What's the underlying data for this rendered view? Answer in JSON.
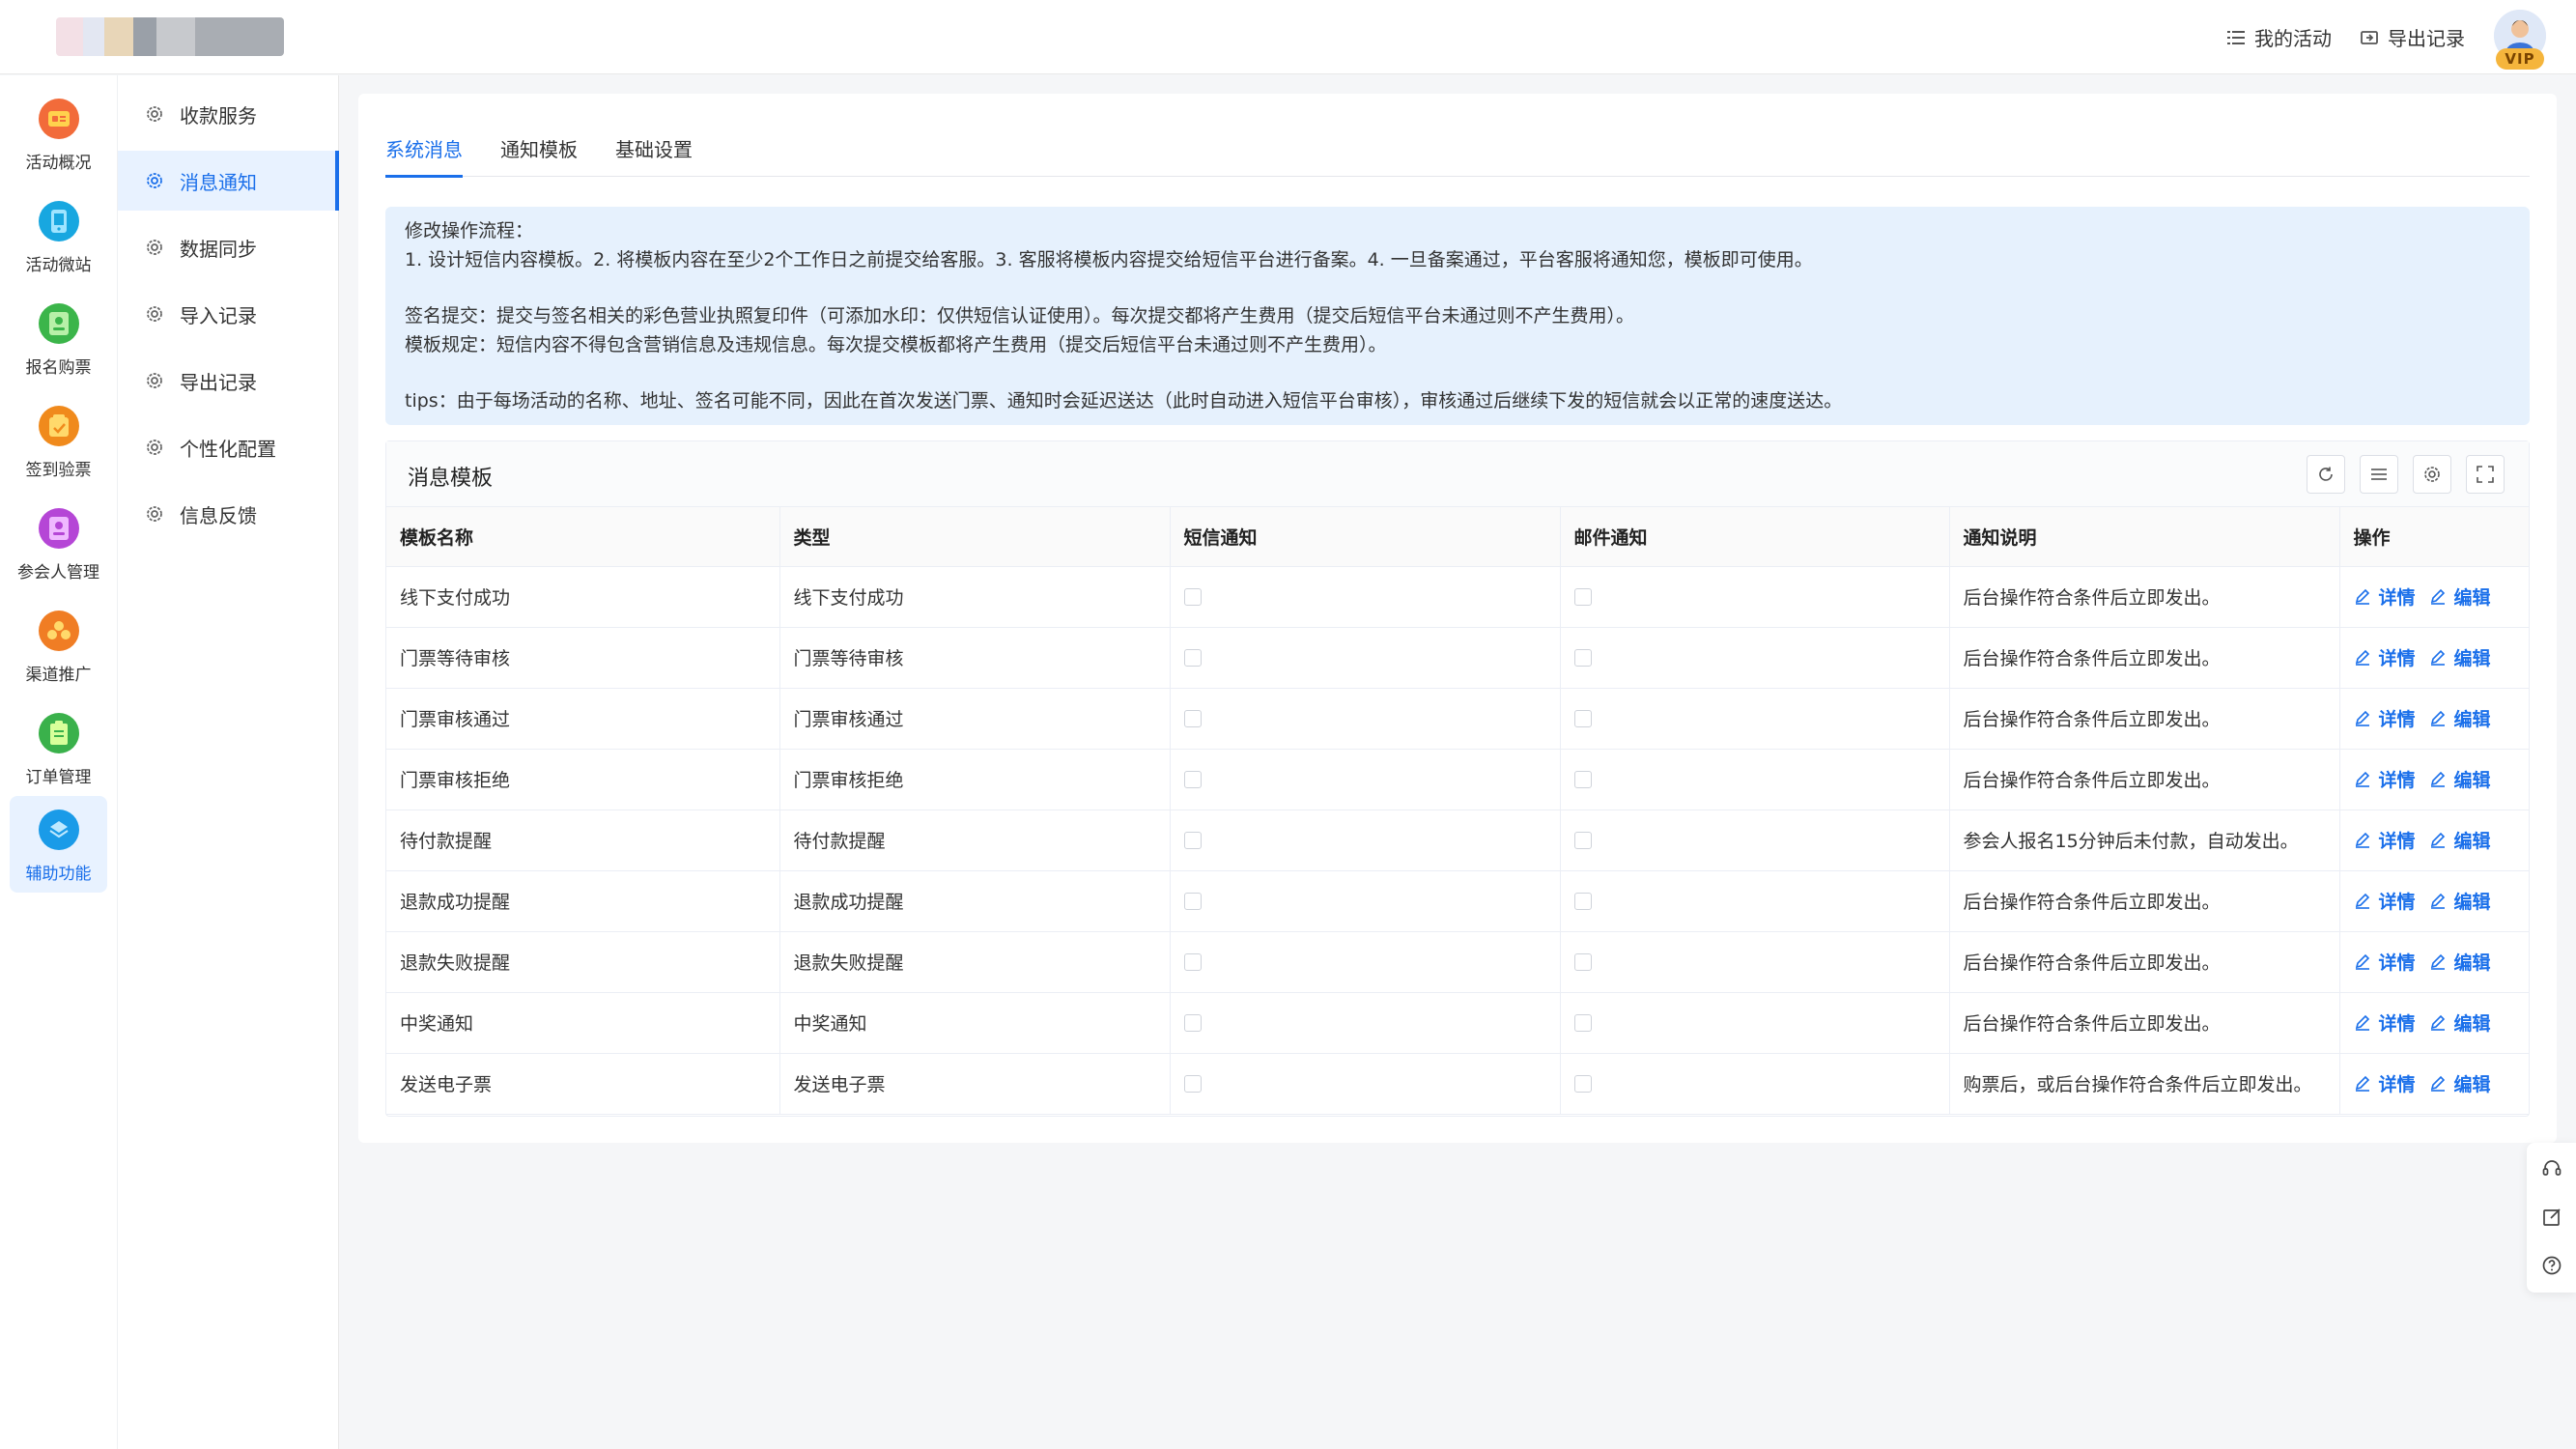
{
  "header": {
    "my_activities": "我的活动",
    "export_records": "导出记录",
    "vip_badge": "VIP"
  },
  "rail": {
    "items": [
      {
        "label": "活动概况",
        "icon": "activity-overview-icon",
        "color": "#f26b3a"
      },
      {
        "label": "活动微站",
        "icon": "mini-site-icon",
        "color": "#18a7e0"
      },
      {
        "label": "报名购票",
        "icon": "registration-ticket-icon",
        "color": "#3bb54a"
      },
      {
        "label": "签到验票",
        "icon": "checkin-icon",
        "color": "#f08a1c"
      },
      {
        "label": "参会人管理",
        "icon": "attendee-icon",
        "color": "#b546d6"
      },
      {
        "label": "渠道推广",
        "icon": "channel-icon",
        "color": "#f07d24"
      },
      {
        "label": "订单管理",
        "icon": "order-icon",
        "color": "#3ab14b"
      },
      {
        "label": "辅助功能",
        "icon": "auxiliary-icon",
        "color": "#1a9be8"
      }
    ],
    "active_index": 7
  },
  "submenu": {
    "items": [
      {
        "label": "收款服务"
      },
      {
        "label": "消息通知"
      },
      {
        "label": "数据同步"
      },
      {
        "label": "导入记录"
      },
      {
        "label": "导出记录"
      },
      {
        "label": "个性化配置"
      },
      {
        "label": "信息反馈"
      }
    ],
    "active_index": 1
  },
  "tabs": [
    {
      "label": "系统消息",
      "active": true
    },
    {
      "label": "通知模板",
      "active": false
    },
    {
      "label": "基础设置",
      "active": false
    }
  ],
  "notice": {
    "line1": "修改操作流程：",
    "line2": "1. 设计短信内容模板。2. 将模板内容在至少2个工作日之前提交给客服。3. 客服将模板内容提交给短信平台进行备案。4. 一旦备案通过，平台客服将通知您，模板即可使用。",
    "line3": "签名提交：提交与签名相关的彩色营业执照复印件（可添加水印：仅供短信认证使用）。每次提交都将产生费用（提交后短信平台未通过则不产生费用）。",
    "line4": "模板规定：短信内容不得包含营销信息及违规信息。每次提交模板都将产生费用（提交后短信平台未通过则不产生费用）。",
    "line5": "tips：由于每场活动的名称、地址、签名可能不同，因此在首次发送门票、通知时会延迟送达（此时自动进入短信平台审核），审核通过后继续下发的短信就会以正常的速度送达。"
  },
  "table": {
    "title": "消息模板",
    "columns": [
      "模板名称",
      "类型",
      "短信通知",
      "邮件通知",
      "通知说明",
      "操作"
    ],
    "detail_label": "详情",
    "edit_label": "编辑",
    "rows": [
      {
        "name": "线下支付成功",
        "type": "线下支付成功",
        "sms": false,
        "email": false,
        "desc": "后台操作符合条件后立即发出。"
      },
      {
        "name": "门票等待审核",
        "type": "门票等待审核",
        "sms": false,
        "email": false,
        "desc": "后台操作符合条件后立即发出。"
      },
      {
        "name": "门票审核通过",
        "type": "门票审核通过",
        "sms": false,
        "email": false,
        "desc": "后台操作符合条件后立即发出。"
      },
      {
        "name": "门票审核拒绝",
        "type": "门票审核拒绝",
        "sms": false,
        "email": false,
        "desc": "后台操作符合条件后立即发出。"
      },
      {
        "name": "待付款提醒",
        "type": "待付款提醒",
        "sms": false,
        "email": false,
        "desc": "参会人报名15分钟后未付款，自动发出。"
      },
      {
        "name": "退款成功提醒",
        "type": "退款成功提醒",
        "sms": false,
        "email": false,
        "desc": "后台操作符合条件后立即发出。"
      },
      {
        "name": "退款失败提醒",
        "type": "退款失败提醒",
        "sms": false,
        "email": false,
        "desc": "后台操作符合条件后立即发出。"
      },
      {
        "name": "中奖通知",
        "type": "中奖通知",
        "sms": false,
        "email": false,
        "desc": "后台操作符合条件后立即发出。"
      },
      {
        "name": "发送电子票",
        "type": "发送电子票",
        "sms": false,
        "email": false,
        "desc": "购票后，或后台操作符合条件后立即发出。"
      }
    ]
  },
  "colors": {
    "accent": "#1a6fea",
    "notice_bg": "#e6f1fd"
  }
}
